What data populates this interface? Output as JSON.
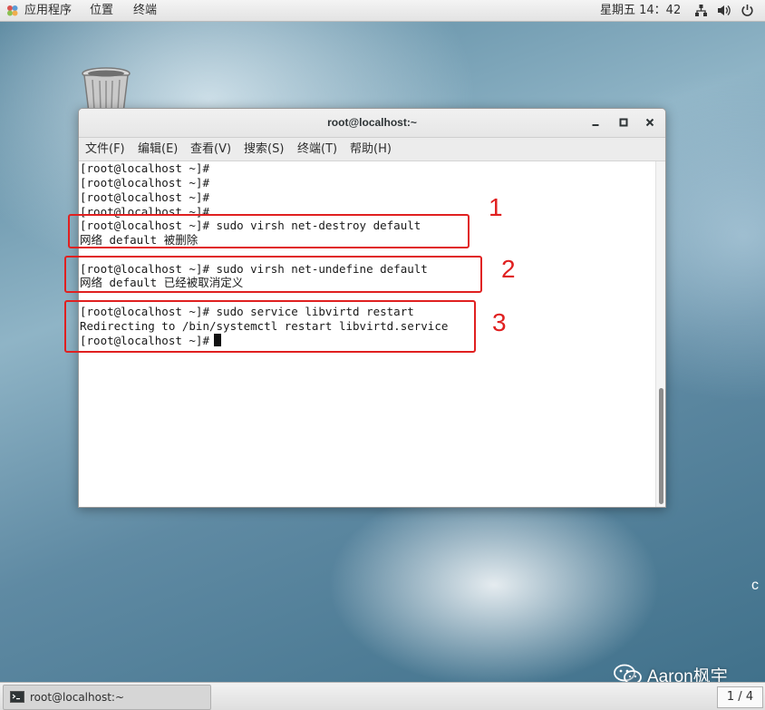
{
  "topbar": {
    "menus": [
      "应用程序",
      "位置",
      "终端"
    ],
    "clock": "星期五 14：42",
    "icons": [
      "network-icon",
      "volume-icon",
      "power-icon"
    ]
  },
  "desktop": {
    "trash_icon": "trash-icon",
    "edge_char": "c"
  },
  "window": {
    "title": "root@localhost:~",
    "menus": [
      "文件(F)",
      "编辑(E)",
      "查看(V)",
      "搜索(S)",
      "终端(T)",
      "帮助(H)"
    ],
    "lines": [
      "[root@localhost ~]#",
      "[root@localhost ~]#",
      "[root@localhost ~]#",
      "[root@localhost ~]#",
      "[root@localhost ~]# sudo virsh net-destroy default",
      "网络 default 被删除",
      "",
      "[root@localhost ~]# sudo virsh net-undefine default",
      "网络 default 已经被取消定义",
      "",
      "[root@localhost ~]# sudo service libvirtd restart",
      "Redirecting to /bin/systemctl restart libvirtd.service",
      "[root@localhost ~]#"
    ]
  },
  "annotations": [
    "1",
    "2",
    "3"
  ],
  "taskbar": {
    "task_label": "root@localhost:~",
    "pager": "1 / 4"
  },
  "watermark": "Aaron枫宇",
  "colors": {
    "annotation": "#e02020",
    "terminal_bg": "#ffffff"
  }
}
